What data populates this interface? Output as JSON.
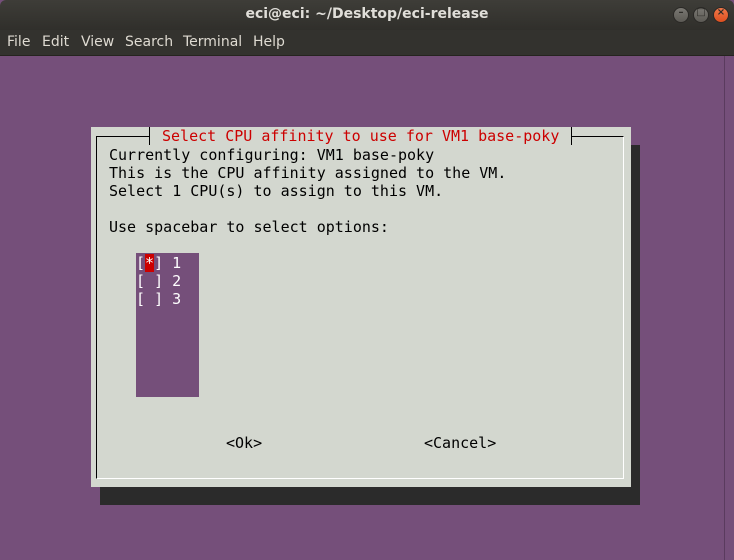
{
  "window": {
    "title": "eci@eci: ~/Desktop/eci-release",
    "buttons": {
      "minimize": "–",
      "maximize": "□",
      "close": "×"
    }
  },
  "menu": [
    "File",
    "Edit",
    "View",
    "Search",
    "Terminal",
    "Help"
  ],
  "dialog": {
    "title": "Select CPU affinity to use for VM1 base-poky",
    "lines": [
      "Currently configuring: VM1 base-poky",
      "This is the CPU affinity assigned to the VM.",
      "Select 1 CPU(s) to assign to this VM.",
      "Use spacebar to select options:"
    ],
    "options": [
      {
        "open": "[",
        "mark": "*",
        "close": "]",
        "label": "1",
        "selected": true
      },
      {
        "open": "[",
        "mark": " ",
        "close": "]",
        "label": "2",
        "selected": false
      },
      {
        "open": "[",
        "mark": " ",
        "close": "]",
        "label": "3",
        "selected": false
      }
    ],
    "ok_label": "<Ok>",
    "cancel_label": "<Cancel>"
  },
  "colors": {
    "terminal_bg": "#754f7a",
    "dialog_bg": "#d3d7cf",
    "title_color": "#cc0000",
    "selection": "#cc0000"
  }
}
